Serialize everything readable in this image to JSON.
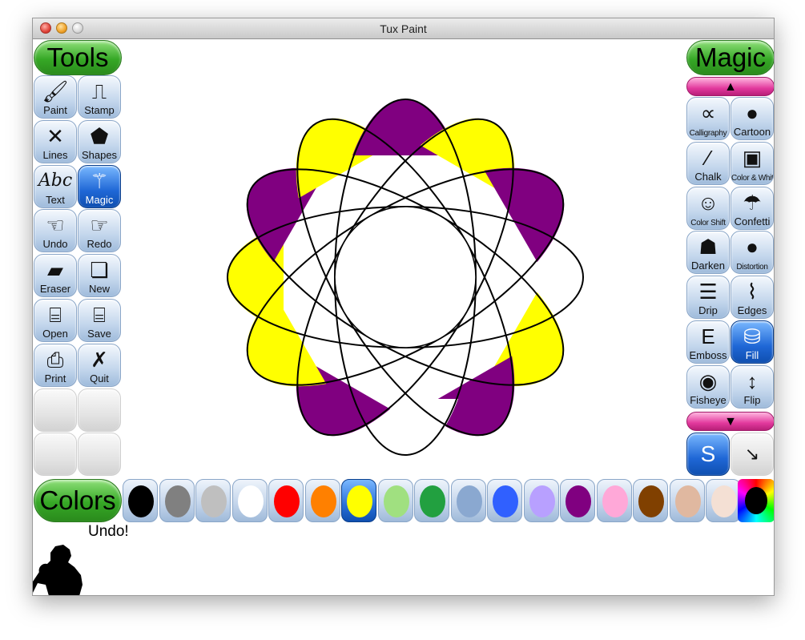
{
  "window": {
    "title": "Tux Paint"
  },
  "tools": {
    "heading": "Tools",
    "items": [
      {
        "label": "Paint",
        "icon": "paintbrush-icon"
      },
      {
        "label": "Stamp",
        "icon": "stamp-icon"
      },
      {
        "label": "Lines",
        "icon": "lines-icon"
      },
      {
        "label": "Shapes",
        "icon": "pentagon-icon"
      },
      {
        "label": "Text",
        "icon": "text-abc-icon"
      },
      {
        "label": "Magic",
        "icon": "magic-wand-icon"
      },
      {
        "label": "Undo",
        "icon": "undo-hand-icon"
      },
      {
        "label": "Redo",
        "icon": "redo-hand-icon"
      },
      {
        "label": "Eraser",
        "icon": "eraser-icon"
      },
      {
        "label": "New",
        "icon": "new-page-icon"
      },
      {
        "label": "Open",
        "icon": "open-book-icon"
      },
      {
        "label": "Save",
        "icon": "save-book-icon"
      },
      {
        "label": "Print",
        "icon": "printer-icon"
      },
      {
        "label": "Quit",
        "icon": "quit-x-icon"
      }
    ],
    "selected": "Magic"
  },
  "magic": {
    "heading": "Magic",
    "items": [
      {
        "label": "Calligraphy",
        "icon": "calligraphy-icon"
      },
      {
        "label": "Cartoon",
        "icon": "cartoon-icon"
      },
      {
        "label": "Chalk",
        "icon": "chalk-icon"
      },
      {
        "label": "Color & White",
        "icon": "color-white-icon"
      },
      {
        "label": "Color Shift",
        "icon": "color-shift-icon"
      },
      {
        "label": "Confetti",
        "icon": "confetti-icon"
      },
      {
        "label": "Darken",
        "icon": "darken-icon"
      },
      {
        "label": "Distortion",
        "icon": "distortion-icon"
      },
      {
        "label": "Drip",
        "icon": "drip-icon"
      },
      {
        "label": "Edges",
        "icon": "edges-icon"
      },
      {
        "label": "Emboss",
        "icon": "emboss-icon"
      },
      {
        "label": "Fill",
        "icon": "fill-bucket-icon"
      },
      {
        "label": "Fisheye",
        "icon": "fisheye-icon"
      },
      {
        "label": "Flip",
        "icon": "flip-arrows-icon"
      }
    ],
    "selected": "Fill",
    "scroll_up": "▲",
    "scroll_down": "▼",
    "mode_buttons": [
      {
        "name": "paint-mode-button",
        "icon": "magic-paint-mode-icon",
        "selected": true
      },
      {
        "name": "fullscreen-mode-button",
        "icon": "magic-fullscreen-mode-icon",
        "selected": false
      }
    ]
  },
  "colors": {
    "heading": "Colors",
    "swatches": [
      "#000000",
      "#808080",
      "#bfbfbf",
      "#ffffff",
      "#ff0000",
      "#ff8000",
      "#ffff00",
      "#a0e080",
      "#22a040",
      "#8aa8d0",
      "#3060ff",
      "#b8a0ff",
      "#800080",
      "#ffa8d8",
      "#804000",
      "#e0b8a0",
      "#f4e0d4"
    ],
    "selected_index": 6,
    "picker_icon": "rainbow-color-picker-icon"
  },
  "status": {
    "message": "Undo!"
  },
  "tux": {
    "icon": "tux-penguin-silhouette-icon"
  },
  "artwork": {
    "palette": {
      "yellow": "#ffff00",
      "purple": "#800080",
      "white": "#ffffff",
      "outline": "#000000"
    }
  }
}
